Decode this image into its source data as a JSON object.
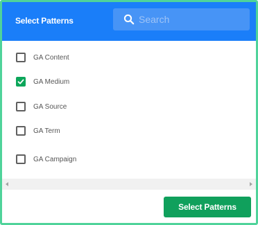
{
  "header": {
    "title": "Select Patterns"
  },
  "search": {
    "placeholder": "Search",
    "value": "",
    "icon": "search-icon"
  },
  "patterns": [
    {
      "label": "GA Content",
      "checked": false
    },
    {
      "label": "GA Medium",
      "checked": true
    },
    {
      "label": "GA Source",
      "checked": false
    },
    {
      "label": "GA Term",
      "checked": false
    },
    {
      "label": "GA Campaign",
      "checked": false
    }
  ],
  "footer": {
    "button_label": "Select Patterns"
  },
  "colors": {
    "header_bg": "#1a7ef9",
    "accent_green": "#10a05c",
    "frame_border": "#4fd39a"
  }
}
